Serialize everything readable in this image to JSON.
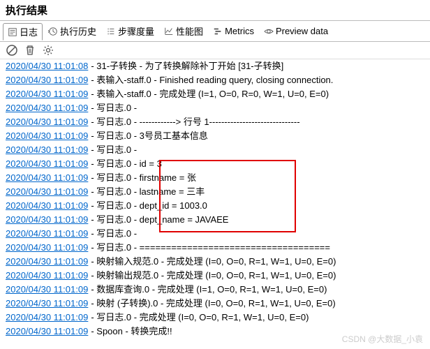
{
  "title": "执行结果",
  "tabs": [
    {
      "label": "日志",
      "icon": "log"
    },
    {
      "label": "执行历史",
      "icon": "history"
    },
    {
      "label": "步骤度量",
      "icon": "metrics"
    },
    {
      "label": "性能图",
      "icon": "perf"
    },
    {
      "label": "Metrics",
      "icon": "metrics2"
    },
    {
      "label": "Preview data",
      "icon": "preview"
    }
  ],
  "toolbar": {
    "stop": "stop-icon",
    "trash": "trash-icon",
    "gear": "gear-icon"
  },
  "logs": [
    {
      "ts": "2020/04/30 11:01:08",
      "msg": "- 31-子转换 - 为了转换解除补丁开始  [31-子转换]"
    },
    {
      "ts": "2020/04/30 11:01:09",
      "msg": "- 表输入-staff.0 - Finished reading query, closing connection."
    },
    {
      "ts": "2020/04/30 11:01:09",
      "msg": "- 表输入-staff.0 - 完成处理 (I=1, O=0, R=0, W=1, U=0, E=0)"
    },
    {
      "ts": "2020/04/30 11:01:09",
      "msg": "- 写日志.0 -"
    },
    {
      "ts": "2020/04/30 11:01:09",
      "msg": "- 写日志.0 - ------------> 行号 1------------------------------"
    },
    {
      "ts": "2020/04/30 11:01:09",
      "msg": "- 写日志.0 - 3号员工基本信息"
    },
    {
      "ts": "2020/04/30 11:01:09",
      "msg": "- 写日志.0 -"
    },
    {
      "ts": "2020/04/30 11:01:09",
      "msg": "- 写日志.0 - id = 3"
    },
    {
      "ts": "2020/04/30 11:01:09",
      "msg": "- 写日志.0 - firstname = 张"
    },
    {
      "ts": "2020/04/30 11:01:09",
      "msg": "- 写日志.0 - lastname = 三丰"
    },
    {
      "ts": "2020/04/30 11:01:09",
      "msg": "- 写日志.0 - dept_id = 1003.0"
    },
    {
      "ts": "2020/04/30 11:01:09",
      "msg": "- 写日志.0 - dept_name = JAVAEE"
    },
    {
      "ts": "2020/04/30 11:01:09",
      "msg": "- 写日志.0 -"
    },
    {
      "ts": "2020/04/30 11:01:09",
      "msg": "- 写日志.0 - ===================================="
    },
    {
      "ts": "2020/04/30 11:01:09",
      "msg": "- 映射输入规范.0 - 完成处理 (I=0, O=0, R=1, W=1, U=0, E=0)"
    },
    {
      "ts": "2020/04/30 11:01:09",
      "msg": "- 映射输出规范.0 - 完成处理 (I=0, O=0, R=1, W=1, U=0, E=0)"
    },
    {
      "ts": "2020/04/30 11:01:09",
      "msg": "- 数据库查询.0 - 完成处理 (I=1, O=0, R=1, W=1, U=0, E=0)"
    },
    {
      "ts": "2020/04/30 11:01:09",
      "msg": "- 映射 (子转换).0 - 完成处理 (I=0, O=0, R=1, W=1, U=0, E=0)"
    },
    {
      "ts": "2020/04/30 11:01:09",
      "msg": "- 写日志.0 - 完成处理 (I=0, O=0, R=1, W=1, U=0, E=0)"
    },
    {
      "ts": "2020/04/30 11:01:09",
      "msg": "- Spoon - 转换完成!!"
    }
  ],
  "watermark": "CSDN @大数据_小袁"
}
